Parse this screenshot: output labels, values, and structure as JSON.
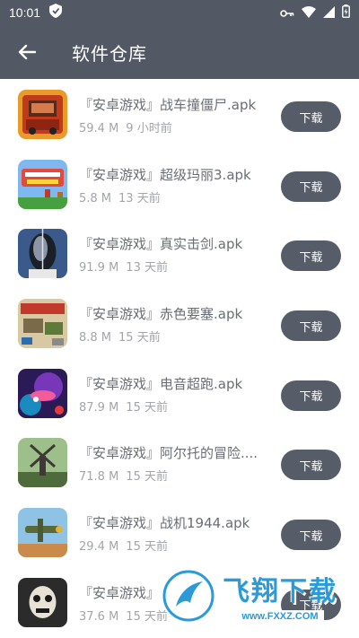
{
  "status_bar": {
    "time": "10:01",
    "icons": [
      "shield-icon",
      "key-icon",
      "wifi-icon",
      "signal-icon",
      "battery-icon"
    ]
  },
  "app_bar": {
    "back_icon": "arrow-left-icon",
    "title": "软件仓库"
  },
  "download_label": "下载",
  "apps": [
    {
      "name": "『安卓游戏』战车撞僵尸.apk",
      "size": "59.4 M",
      "time": "9 小时前",
      "icon": "zombie-truck-game-icon"
    },
    {
      "name": "『安卓游戏』超级玛丽3.apk",
      "size": "5.8 M",
      "time": "13 天前",
      "icon": "super-mario-game-icon"
    },
    {
      "name": "『安卓游戏』真实击剑.apk",
      "size": "91.9 M",
      "time": "13 天前",
      "icon": "fencing-mask-game-icon"
    },
    {
      "name": "『安卓游戏』赤色要塞.apk",
      "size": "8.8 M",
      "time": "15 天前",
      "icon": "red-fortress-game-icon"
    },
    {
      "name": "『安卓游戏』电音超跑.apk",
      "size": "87.9 M",
      "time": "15 天前",
      "icon": "neon-racer-game-icon"
    },
    {
      "name": "『安卓游戏』阿尔托的冒险....",
      "size": "71.8 M",
      "time": "15 天前",
      "icon": "alto-windmill-game-icon"
    },
    {
      "name": "『安卓游戏』战机1944.apk",
      "size": "29.4 M",
      "time": "15 天前",
      "icon": "warplane-1944-game-icon"
    },
    {
      "name": "『安卓游戏』",
      "size": "37.6 M",
      "time": "15 天前",
      "icon": "grim-reaper-game-icon"
    }
  ],
  "watermark": {
    "text": "飞翔下载",
    "url": "www.FXXZ.COM"
  }
}
